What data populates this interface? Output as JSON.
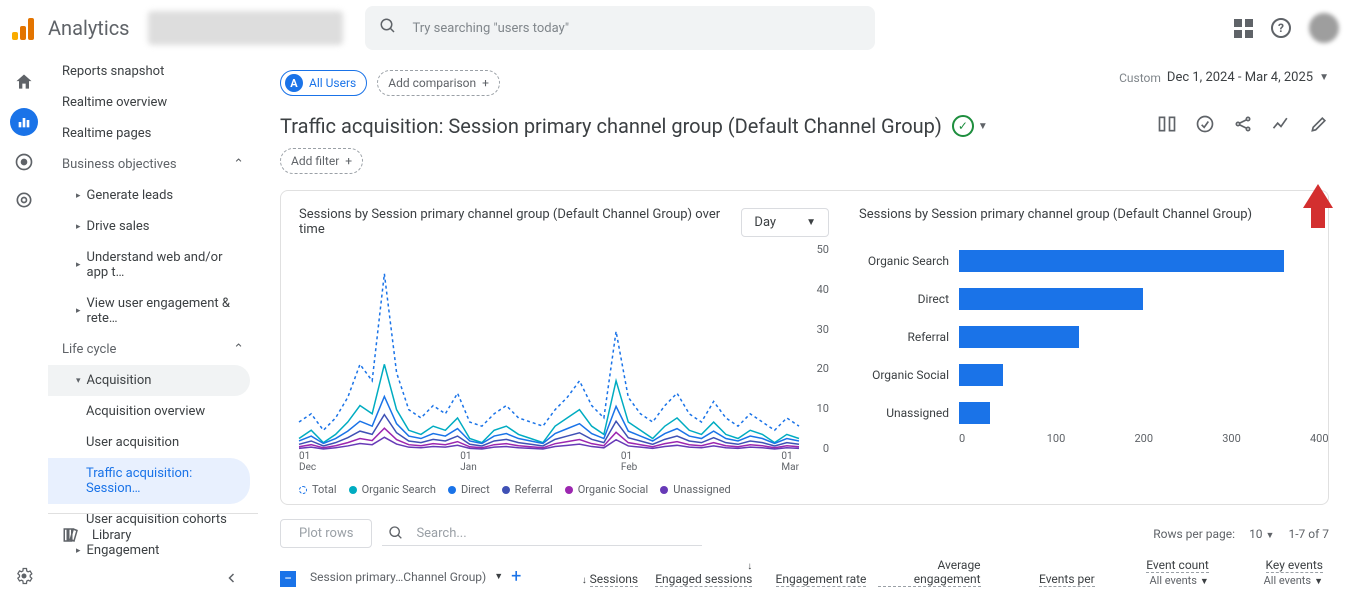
{
  "brand": "Analytics",
  "search_placeholder": "Try searching \"users today\"",
  "nav": {
    "snapshot": "Reports snapshot",
    "realtime_overview": "Realtime overview",
    "realtime_pages": "Realtime pages",
    "business": "Business objectives",
    "gen_leads": "Generate leads",
    "drive_sales": "Drive sales",
    "understand": "Understand web and/or app t…",
    "view_eng": "View user engagement & rete…",
    "life_cycle": "Life cycle",
    "acquisition": "Acquisition",
    "acq_over": "Acquisition overview",
    "user_acq": "User acquisition",
    "traffic_acq": "Traffic acquisition: Session…",
    "user_cohort": "User acquisition cohorts",
    "engagement": "Engagement",
    "library": "Library"
  },
  "chips": {
    "all_users": "All Users",
    "add_comparison": "Add comparison"
  },
  "date": {
    "custom": "Custom",
    "range": "Dec 1, 2024 - Mar 4, 2025"
  },
  "page_title": "Traffic acquisition: Session primary channel group (Default Channel Group)",
  "add_filter": "Add filter",
  "chart_data": {
    "line": {
      "type": "line",
      "title": "Sessions by Session primary channel group (Default Channel Group) over time",
      "granularity": "Day",
      "y_ticks": [
        0,
        10,
        20,
        30,
        40,
        50
      ],
      "x_ticks": [
        "01\nDec",
        "01\nJan",
        "01\nFeb",
        "01\nMar"
      ],
      "series": [
        {
          "name": "Total",
          "color": "#1a73e8",
          "dashed": true
        },
        {
          "name": "Organic Search",
          "color": "#00acc1"
        },
        {
          "name": "Direct",
          "color": "#1a73e8"
        },
        {
          "name": "Referral",
          "color": "#3f51b5"
        },
        {
          "name": "Organic Social",
          "color": "#9c27b0"
        },
        {
          "name": "Unassigned",
          "color": "#673ab7"
        }
      ],
      "sample_points_total": [
        8,
        10,
        6,
        9,
        14,
        22,
        18,
        44,
        20,
        11,
        9,
        12,
        10,
        15,
        8,
        7,
        10,
        12,
        9,
        8,
        7,
        11,
        14,
        18,
        12,
        9,
        30,
        14,
        10,
        8,
        12,
        15,
        10,
        8,
        13,
        9,
        7,
        10,
        8,
        6,
        9,
        7
      ],
      "sample_points_organic": [
        4,
        6,
        3,
        5,
        8,
        12,
        10,
        22,
        11,
        6,
        5,
        7,
        6,
        9,
        4,
        3,
        6,
        7,
        5,
        4,
        3,
        7,
        9,
        11,
        7,
        5,
        18,
        8,
        6,
        4,
        7,
        9,
        6,
        5,
        8,
        5,
        4,
        6,
        5,
        3,
        5,
        4
      ]
    },
    "bar": {
      "type": "bar",
      "title": "Sessions by Session primary channel group (Default Channel Group)",
      "categories": [
        "Organic Search",
        "Direct",
        "Referral",
        "Organic Social",
        "Unassigned"
      ],
      "values": [
        370,
        210,
        137,
        50,
        35
      ],
      "x_ticks": [
        0,
        100,
        200,
        300,
        400
      ],
      "xmax": 400
    }
  },
  "table": {
    "plot_rows": "Plot rows",
    "search": "Search...",
    "rows_label": "Rows per page:",
    "rows_val": "10",
    "pager": "1-7 of 7",
    "dim_head": "Session primary…Channel Group)",
    "cols": {
      "sessions": "Sessions",
      "engaged": "Engaged sessions",
      "eng_rate": "Engagement rate",
      "avg_eng": "Average engagement",
      "events_per": "Events per",
      "event_count": "Event count",
      "event_count_sub": "All events",
      "key_events": "Key events",
      "key_events_sub": "All events"
    }
  }
}
